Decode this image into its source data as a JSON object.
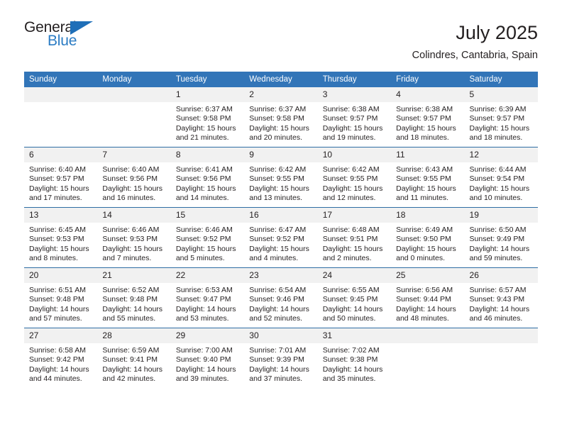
{
  "brand": {
    "name_primary": "General",
    "name_secondary": "Blue",
    "triangle_icon": "triangle-icon",
    "accent_color": "#2b7cc4"
  },
  "header": {
    "title": "July 2025",
    "subtitle": "Colindres, Cantabria, Spain"
  },
  "calendar": {
    "header_background": "#3275b8",
    "daynum_background": "#f1f1f1",
    "row_divider_color": "#2e6da4",
    "weekday_headers": [
      "Sunday",
      "Monday",
      "Tuesday",
      "Wednesday",
      "Thursday",
      "Friday",
      "Saturday"
    ],
    "weeks": [
      [
        {
          "day": "",
          "lines": []
        },
        {
          "day": "",
          "lines": []
        },
        {
          "day": "1",
          "lines": [
            "Sunrise: 6:37 AM",
            "Sunset: 9:58 PM",
            "Daylight: 15 hours",
            "and 21 minutes."
          ]
        },
        {
          "day": "2",
          "lines": [
            "Sunrise: 6:37 AM",
            "Sunset: 9:58 PM",
            "Daylight: 15 hours",
            "and 20 minutes."
          ]
        },
        {
          "day": "3",
          "lines": [
            "Sunrise: 6:38 AM",
            "Sunset: 9:57 PM",
            "Daylight: 15 hours",
            "and 19 minutes."
          ]
        },
        {
          "day": "4",
          "lines": [
            "Sunrise: 6:38 AM",
            "Sunset: 9:57 PM",
            "Daylight: 15 hours",
            "and 18 minutes."
          ]
        },
        {
          "day": "5",
          "lines": [
            "Sunrise: 6:39 AM",
            "Sunset: 9:57 PM",
            "Daylight: 15 hours",
            "and 18 minutes."
          ]
        }
      ],
      [
        {
          "day": "6",
          "lines": [
            "Sunrise: 6:40 AM",
            "Sunset: 9:57 PM",
            "Daylight: 15 hours",
            "and 17 minutes."
          ]
        },
        {
          "day": "7",
          "lines": [
            "Sunrise: 6:40 AM",
            "Sunset: 9:56 PM",
            "Daylight: 15 hours",
            "and 16 minutes."
          ]
        },
        {
          "day": "8",
          "lines": [
            "Sunrise: 6:41 AM",
            "Sunset: 9:56 PM",
            "Daylight: 15 hours",
            "and 14 minutes."
          ]
        },
        {
          "day": "9",
          "lines": [
            "Sunrise: 6:42 AM",
            "Sunset: 9:55 PM",
            "Daylight: 15 hours",
            "and 13 minutes."
          ]
        },
        {
          "day": "10",
          "lines": [
            "Sunrise: 6:42 AM",
            "Sunset: 9:55 PM",
            "Daylight: 15 hours",
            "and 12 minutes."
          ]
        },
        {
          "day": "11",
          "lines": [
            "Sunrise: 6:43 AM",
            "Sunset: 9:55 PM",
            "Daylight: 15 hours",
            "and 11 minutes."
          ]
        },
        {
          "day": "12",
          "lines": [
            "Sunrise: 6:44 AM",
            "Sunset: 9:54 PM",
            "Daylight: 15 hours",
            "and 10 minutes."
          ]
        }
      ],
      [
        {
          "day": "13",
          "lines": [
            "Sunrise: 6:45 AM",
            "Sunset: 9:53 PM",
            "Daylight: 15 hours",
            "and 8 minutes."
          ]
        },
        {
          "day": "14",
          "lines": [
            "Sunrise: 6:46 AM",
            "Sunset: 9:53 PM",
            "Daylight: 15 hours",
            "and 7 minutes."
          ]
        },
        {
          "day": "15",
          "lines": [
            "Sunrise: 6:46 AM",
            "Sunset: 9:52 PM",
            "Daylight: 15 hours",
            "and 5 minutes."
          ]
        },
        {
          "day": "16",
          "lines": [
            "Sunrise: 6:47 AM",
            "Sunset: 9:52 PM",
            "Daylight: 15 hours",
            "and 4 minutes."
          ]
        },
        {
          "day": "17",
          "lines": [
            "Sunrise: 6:48 AM",
            "Sunset: 9:51 PM",
            "Daylight: 15 hours",
            "and 2 minutes."
          ]
        },
        {
          "day": "18",
          "lines": [
            "Sunrise: 6:49 AM",
            "Sunset: 9:50 PM",
            "Daylight: 15 hours",
            "and 0 minutes."
          ]
        },
        {
          "day": "19",
          "lines": [
            "Sunrise: 6:50 AM",
            "Sunset: 9:49 PM",
            "Daylight: 14 hours",
            "and 59 minutes."
          ]
        }
      ],
      [
        {
          "day": "20",
          "lines": [
            "Sunrise: 6:51 AM",
            "Sunset: 9:48 PM",
            "Daylight: 14 hours",
            "and 57 minutes."
          ]
        },
        {
          "day": "21",
          "lines": [
            "Sunrise: 6:52 AM",
            "Sunset: 9:48 PM",
            "Daylight: 14 hours",
            "and 55 minutes."
          ]
        },
        {
          "day": "22",
          "lines": [
            "Sunrise: 6:53 AM",
            "Sunset: 9:47 PM",
            "Daylight: 14 hours",
            "and 53 minutes."
          ]
        },
        {
          "day": "23",
          "lines": [
            "Sunrise: 6:54 AM",
            "Sunset: 9:46 PM",
            "Daylight: 14 hours",
            "and 52 minutes."
          ]
        },
        {
          "day": "24",
          "lines": [
            "Sunrise: 6:55 AM",
            "Sunset: 9:45 PM",
            "Daylight: 14 hours",
            "and 50 minutes."
          ]
        },
        {
          "day": "25",
          "lines": [
            "Sunrise: 6:56 AM",
            "Sunset: 9:44 PM",
            "Daylight: 14 hours",
            "and 48 minutes."
          ]
        },
        {
          "day": "26",
          "lines": [
            "Sunrise: 6:57 AM",
            "Sunset: 9:43 PM",
            "Daylight: 14 hours",
            "and 46 minutes."
          ]
        }
      ],
      [
        {
          "day": "27",
          "lines": [
            "Sunrise: 6:58 AM",
            "Sunset: 9:42 PM",
            "Daylight: 14 hours",
            "and 44 minutes."
          ]
        },
        {
          "day": "28",
          "lines": [
            "Sunrise: 6:59 AM",
            "Sunset: 9:41 PM",
            "Daylight: 14 hours",
            "and 42 minutes."
          ]
        },
        {
          "day": "29",
          "lines": [
            "Sunrise: 7:00 AM",
            "Sunset: 9:40 PM",
            "Daylight: 14 hours",
            "and 39 minutes."
          ]
        },
        {
          "day": "30",
          "lines": [
            "Sunrise: 7:01 AM",
            "Sunset: 9:39 PM",
            "Daylight: 14 hours",
            "and 37 minutes."
          ]
        },
        {
          "day": "31",
          "lines": [
            "Sunrise: 7:02 AM",
            "Sunset: 9:38 PM",
            "Daylight: 14 hours",
            "and 35 minutes."
          ]
        },
        {
          "day": "",
          "lines": []
        },
        {
          "day": "",
          "lines": []
        }
      ]
    ]
  }
}
